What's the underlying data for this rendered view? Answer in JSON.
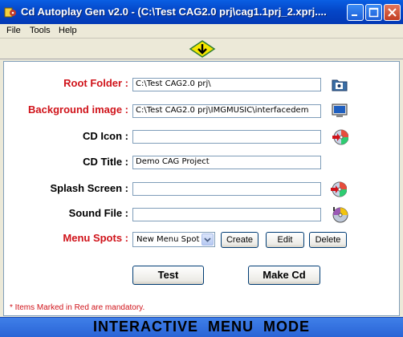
{
  "window": {
    "title": "Cd Autoplay Gen v2.0 - (C:\\Test CAG2.0 prj\\cag1.1prj_2.xprj...."
  },
  "menu": [
    "File",
    "Tools",
    "Help"
  ],
  "form": {
    "root_folder": {
      "label": "Root Folder :",
      "value": "C:\\Test CAG2.0 prj\\"
    },
    "background_image": {
      "label": "Background image :",
      "value": "C:\\Test CAG2.0 prj\\IMGMUSIC\\interfacedem"
    },
    "cd_icon": {
      "label": "CD Icon :",
      "value": ""
    },
    "cd_title": {
      "label": "CD Title :",
      "value": "Demo CAG Project"
    },
    "splash_screen": {
      "label": "Splash Screen :",
      "value": ""
    },
    "sound_file": {
      "label": "Sound File :",
      "value": ""
    },
    "menu_spots": {
      "label": "Menu Spots :",
      "selected": "New Menu Spot"
    }
  },
  "buttons": {
    "create": "Create",
    "edit": "Edit",
    "delete": "Delete",
    "test": "Test",
    "make_cd": "Make Cd"
  },
  "footnote": "* Items Marked in Red are mandatory.",
  "status": "INTERACTIVE  MENU  MODE",
  "colors": {
    "mandatory_label": "#D0131A",
    "titlebar": "#0446C7",
    "statusbar": "#2A64D6"
  },
  "icons": [
    "app-icon",
    "down-arrow-icon",
    "folder-icon",
    "monitor-icon",
    "cd-icon",
    "disk-icon"
  ]
}
